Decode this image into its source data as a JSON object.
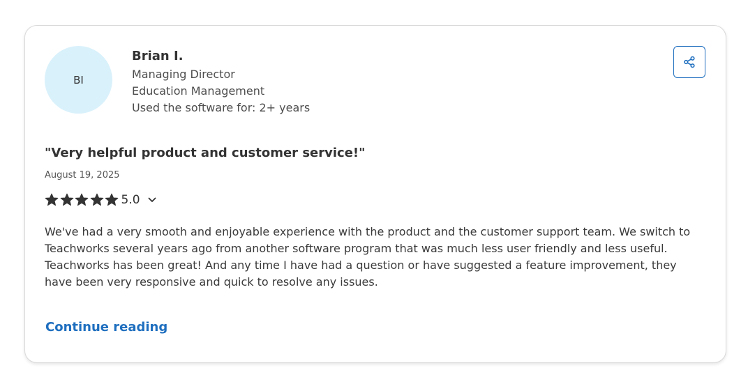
{
  "reviewer": {
    "initials": "BI",
    "name": "Brian I.",
    "role": "Managing Director",
    "industry": "Education Management",
    "usage": "Used the software for: 2+ years"
  },
  "review": {
    "title": "\"Very helpful product and customer service!\"",
    "date": "August 19, 2025",
    "rating": "5.0",
    "stars_filled": 5,
    "stars_total": 5,
    "body": "We've had a very smooth and enjoyable experience with the product and the customer support team. We switch to Teachworks several years ago from another software program that was much less user friendly and less useful. Teachworks has been great! And any time I have had a question or have suggested a feature improvement, they have been very responsive and quick to resolve any issues.",
    "continue_label": "Continue reading"
  },
  "actions": {
    "share_icon": "share-icon",
    "expand_icon": "chevron-down-icon"
  },
  "colors": {
    "accent": "#1f6fbf",
    "avatar_bg": "#d9f1fb",
    "star": "#333333"
  }
}
